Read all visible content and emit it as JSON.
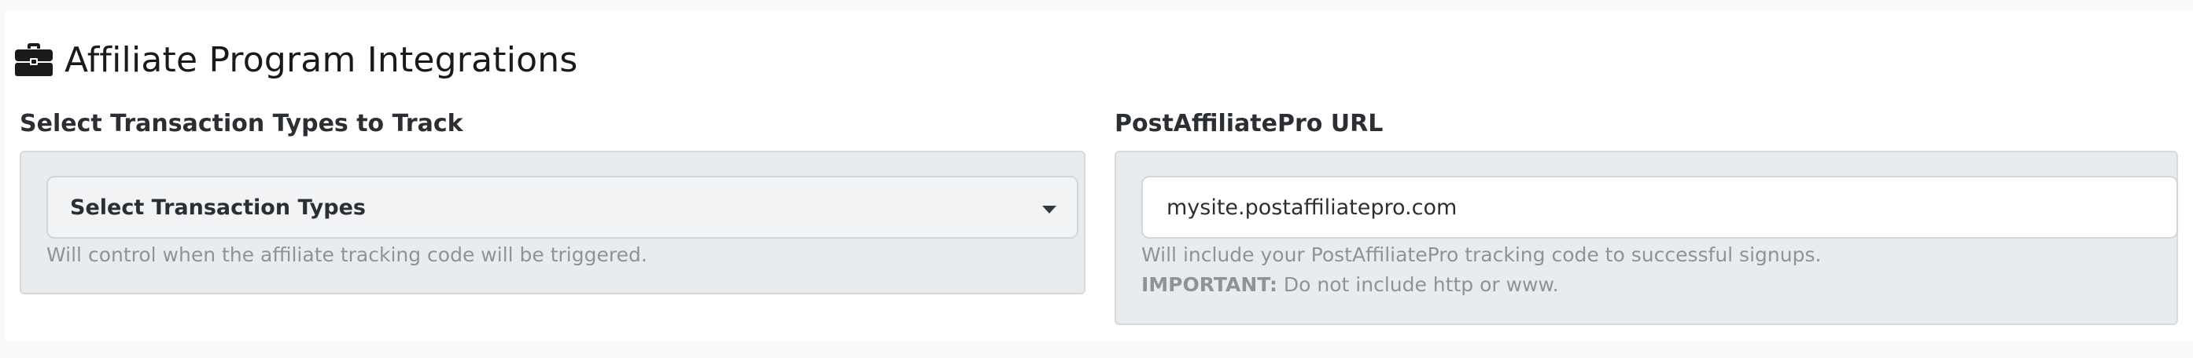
{
  "section": {
    "title": "Affiliate Program Integrations",
    "icon": "briefcase-icon"
  },
  "transaction_types": {
    "label": "Select Transaction Types to Track",
    "select_placeholder": "Select Transaction Types",
    "help_text": "Will control when the affiliate tracking code will be triggered."
  },
  "postaffiliatepro": {
    "label": "PostAffiliatePro URL",
    "url_value": "mysite.postaffiliatepro.com",
    "help_text": "Will include your PostAffiliatePro tracking code to successful signups.",
    "important_label": "IMPORTANT:",
    "important_text": " Do not include http or www."
  }
}
